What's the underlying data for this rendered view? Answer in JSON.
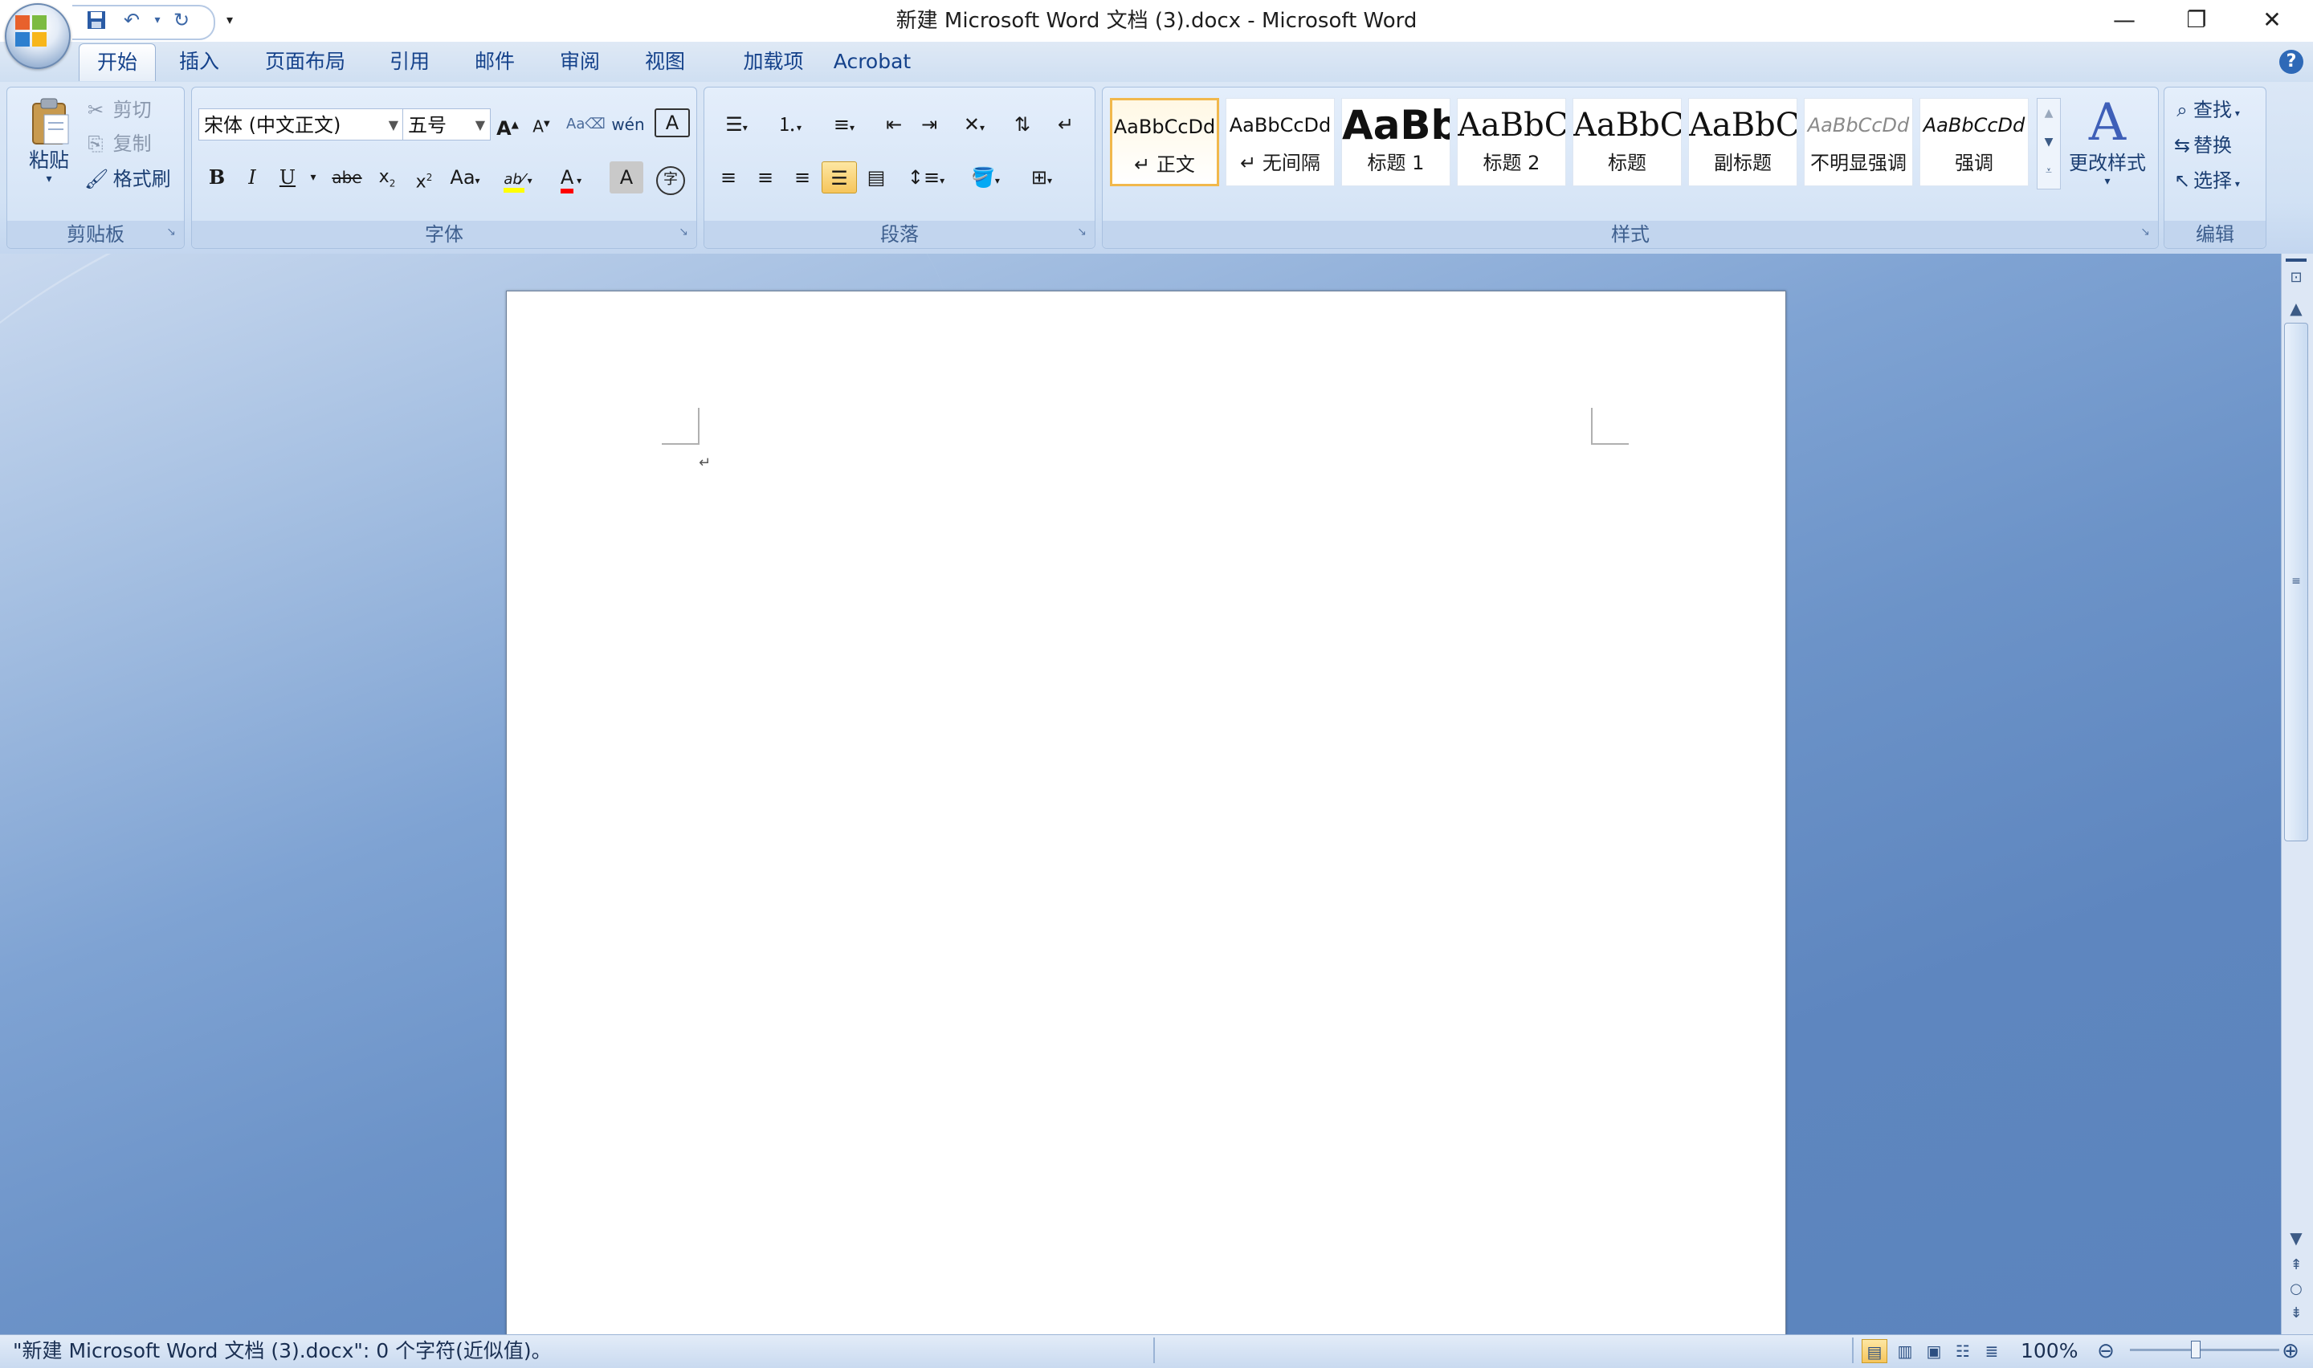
{
  "window": {
    "title": "新建 Microsoft Word 文档 (3).docx - Microsoft Word",
    "minimize": "—",
    "restore": "❐",
    "close": "✕"
  },
  "qat": {
    "save_icon": "save-icon",
    "undo_icon": "undo-icon",
    "redo_icon": "redo-icon",
    "customize_icon": "chevron-down-icon"
  },
  "tabs": [
    "开始",
    "插入",
    "页面布局",
    "引用",
    "邮件",
    "审阅",
    "视图",
    "加载项",
    "Acrobat"
  ],
  "active_tab": "开始",
  "clipboard": {
    "label": "剪贴板",
    "paste": "粘贴",
    "cut": "剪切",
    "copy": "复制",
    "format_painter": "格式刷"
  },
  "font": {
    "label": "字体",
    "font_name": "宋体 (中文正文)",
    "font_size": "五号",
    "bold": "B",
    "italic": "I",
    "underline": "U",
    "strike": "abe",
    "change_case": "Aa",
    "font_color": "A",
    "highlight_color": "#ffff00",
    "font_color_value": "#ff0000"
  },
  "paragraph": {
    "label": "段落"
  },
  "styles": {
    "label": "样式",
    "items": [
      {
        "sample": "AaBbCcDd",
        "name": "↵ 正文",
        "selected": true
      },
      {
        "sample": "AaBbCcDd",
        "name": "↵ 无间隔"
      },
      {
        "sample": "AaBb",
        "name": "标题 1"
      },
      {
        "sample": "AaBbC",
        "name": "标题 2"
      },
      {
        "sample": "AaBbC",
        "name": "标题"
      },
      {
        "sample": "AaBbC",
        "name": "副标题"
      },
      {
        "sample": "AaBbCcDd",
        "name": "不明显强调"
      },
      {
        "sample": "AaBbCcDd",
        "name": "强调"
      }
    ],
    "change_styles": "更改样式"
  },
  "editing": {
    "label": "编辑",
    "find": "查找",
    "replace": "替换",
    "select": "选择"
  },
  "document": {
    "paragraph_mark": "↵"
  },
  "status": {
    "text": "\"新建 Microsoft Word 文档 (3).docx\": 0 个字符(近似值)。",
    "zoom": "100%"
  }
}
